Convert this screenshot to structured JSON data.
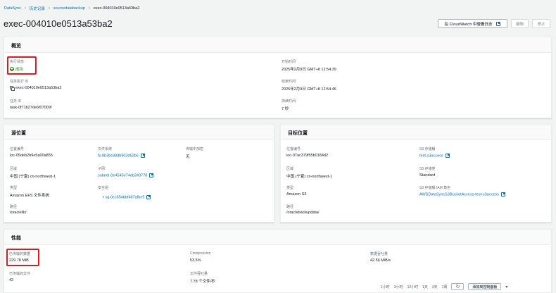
{
  "breadcrumb": {
    "items": [
      "DataSync",
      "历史记录",
      "sourcedatabackup",
      "exec-004010e0513a53ba2"
    ]
  },
  "header": {
    "title": "exec-004010e0513a53ba2",
    "cloudwatch_button": "在 CloudWatch 中查看日志",
    "edit_button": "编辑",
    "stop_button": "停止"
  },
  "overview": {
    "title": "概览",
    "status_label": "执行状态",
    "status_value": "成功",
    "exec_id_label": "任务执行 ID",
    "exec_id_value": "exec-004010e0513a53ba2",
    "task_id_label": "任务 ID",
    "task_id_value": "task-0f71b27de6f07009f",
    "start_label": "开始时间",
    "start_value": "2025年2月9日 GMT+8 12:54:39",
    "end_label": "结束时间",
    "end_value": "2025年2月9日 GMT+8 12:54:46",
    "duration_label": "持续时间",
    "duration_value": "7 秒"
  },
  "source": {
    "title": "源位置",
    "loc_id_label": "位置编号",
    "loc_id_value": "loc-05deb2b9e5a00a855",
    "region_label": "区域",
    "region_value": "中国 (宁夏) cn-northwest-1",
    "type_label": "类型",
    "type_value": "Amazon EFS 文件系统",
    "path_label": "路径",
    "path_value": "/oraclelib/",
    "fs_label": "文件系统",
    "fs_value": "fs-0b3bc98db903d52b6",
    "subnet_label": "子网",
    "subnet_value": "subnet-0e4545e74eb243778",
    "sg_label": "安全组",
    "sg_value": "sg-0cc654bbf487afbe5",
    "encrypt_label": "传输中加密",
    "encrypt_value": "无"
  },
  "destination": {
    "title": "目标位置",
    "loc_id_label": "位置编号",
    "loc_id_value": "loc-07ac379f55b0184d2",
    "region_label": "区域",
    "region_value": "中国 (宁夏) cn-northwest-1",
    "type_label": "类型",
    "type_value": "Amazon S3",
    "path_label": "路径",
    "path_value": "/oraclebackupdata/",
    "bucket_label": "S3 存储桶",
    "bucket_value": "test-s3access",
    "class_label": "S3 存储类",
    "class_value": "Standard",
    "role_label": "S3 存储桶 IAM 角色",
    "role_value": "AWSDataSyncS3BucketAccess-test-s3access"
  },
  "performance": {
    "title": "性能",
    "data_label": "已传输的数据",
    "data_value": "229.78 MiB",
    "files_label": "已传输的文件",
    "files_value": "42",
    "compression_label": "Compression",
    "compression_value": "53.5%",
    "file_tput_label": "文件吞吐量",
    "file_tput_value": "7.78 个文件/秒",
    "data_tput_label": "数据吞吐量",
    "data_tput_value": "42.56 MiB/s",
    "time_ranges": [
      "1小时",
      "3小时",
      "12小时",
      "1天",
      "3天",
      "1周"
    ],
    "add_dashboard": "添加到控制面板"
  },
  "colors": {
    "link": "#0073bb",
    "success": "#1d8102",
    "highlight": "#e0191f"
  }
}
